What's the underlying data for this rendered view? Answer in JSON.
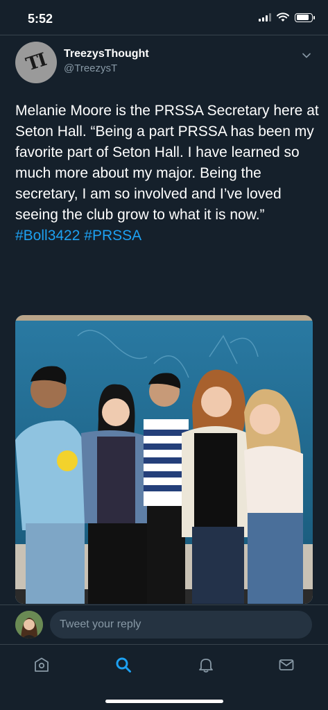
{
  "status_bar": {
    "time": "5:52",
    "battery_level": 0.85
  },
  "tweet": {
    "display_name": "TreezysThought",
    "handle": "@TreezysT",
    "avatar_text": "TI",
    "text": "Melanie Moore is the PRSSA Secretary here at Seton Hall. “Being a part PRSSA has been my favorite part of Seton Hall. I have learned so much more about my major. Being the secretary, I am so involved and I’ve loved seeing the club grow to what it is now.” ",
    "hashtags": [
      "#Boll3422",
      "#PRSSA"
    ]
  },
  "reply": {
    "placeholder": "Tweet your reply"
  },
  "tabs": [
    {
      "name": "home-icon",
      "active": false
    },
    {
      "name": "search-icon",
      "active": true
    },
    {
      "name": "bell-icon",
      "active": false
    },
    {
      "name": "mail-icon",
      "active": false
    }
  ],
  "colors": {
    "background": "#15202b",
    "accent": "#1da1f2",
    "muted": "#8899a6",
    "border": "#38444d"
  }
}
